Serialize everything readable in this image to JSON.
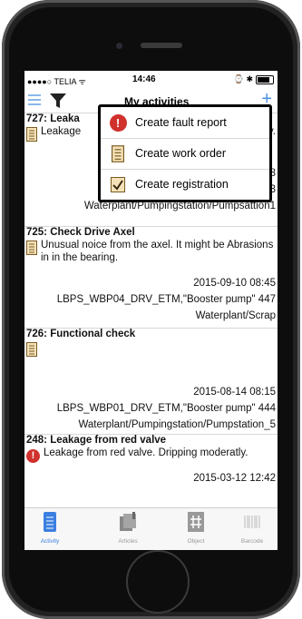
{
  "statusbar": {
    "carrier": "●●●●○ TELIA ᯤ",
    "time": "14:46",
    "right": "⌚ ✱"
  },
  "navbar": {
    "title": "My activities",
    "add": "+"
  },
  "popup": {
    "items": [
      {
        "label": "Create fault report",
        "icon": "warning-icon"
      },
      {
        "label": "Create work order",
        "icon": "document-icon"
      },
      {
        "label": "Create registration",
        "icon": "checkbox-icon"
      }
    ]
  },
  "activities": [
    {
      "title": "727: Leaka",
      "description": "Leakage",
      "description_tail": "ately.",
      "date": ":28",
      "equipment": "443",
      "location": "Waterplant/Pumpingstation/Pumpsattion1",
      "icon": "document-icon"
    },
    {
      "title": "725: Check Drive Axel",
      "description": "Unusual noice from the axel. It might be Abrasions in in the bearing.",
      "date": "2015-09-10 08:45",
      "equipment": "LBPS_WBP04_DRV_ETM,\"Booster pump\" 447",
      "location": "Waterplant/Scrap",
      "icon": "document-icon"
    },
    {
      "title": "726: Functional check",
      "description": "",
      "date": "2015-08-14 08:15",
      "equipment": "LBPS_WBP01_DRV_ETM,\"Booster pump\" 444",
      "location": "Waterplant/Pumpingstation/Pumpstation_5",
      "icon": "document-icon"
    },
    {
      "title": "248: Leakage from red valve",
      "description": "Leakage from red valve. Dripping moderatly.",
      "date": "2015-03-12 12:42",
      "icon": "warning-icon"
    }
  ],
  "tabbar": {
    "tabs": [
      {
        "label": "Activity",
        "icon": "activity-icon",
        "active": true
      },
      {
        "label": "Articles",
        "icon": "articles-icon",
        "active": false
      },
      {
        "label": "Object",
        "icon": "object-icon",
        "active": false
      },
      {
        "label": "Barcode",
        "icon": "barcode-icon",
        "active": false
      }
    ]
  },
  "colors": {
    "accent": "#3a7fe0",
    "warning": "#d0312d"
  }
}
